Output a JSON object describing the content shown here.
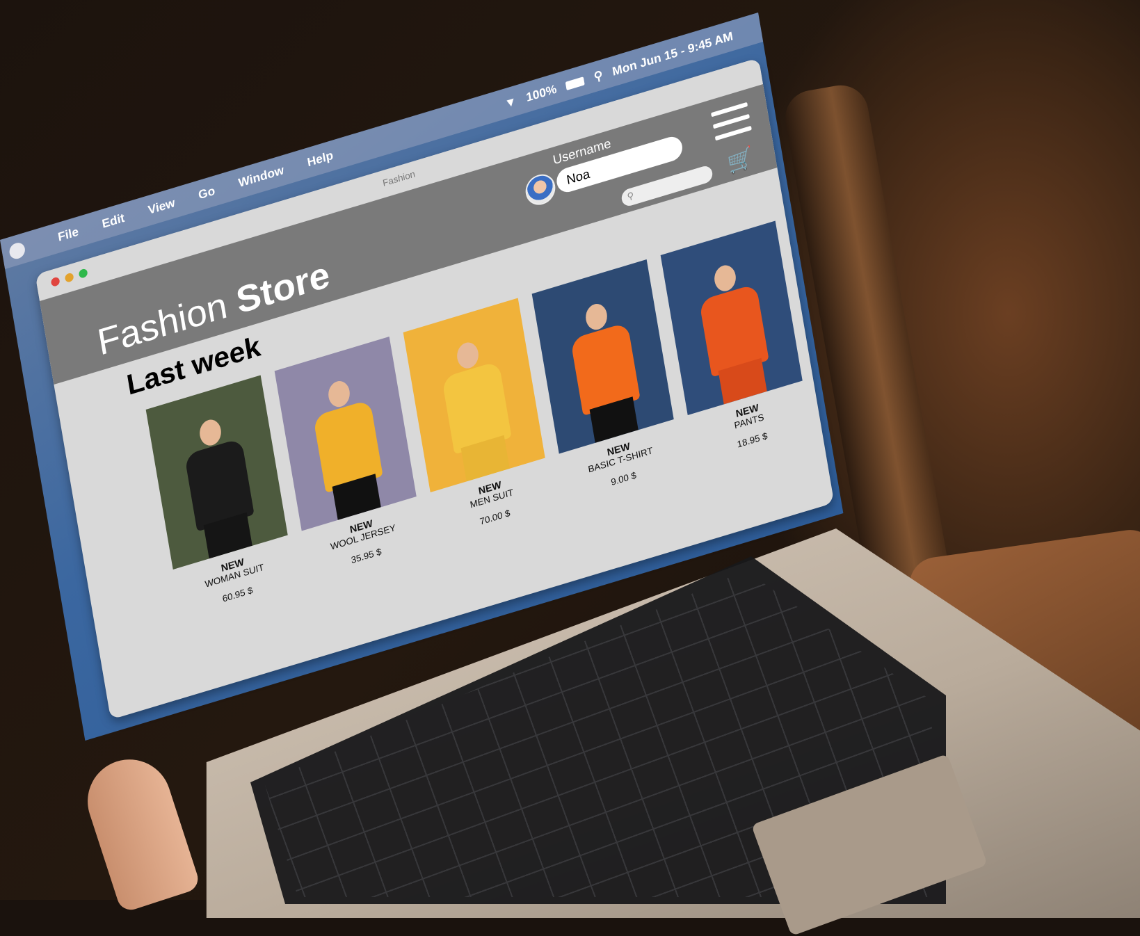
{
  "menubar": {
    "items": [
      "File",
      "Edit",
      "View",
      "Go",
      "Window",
      "Help"
    ],
    "wifi_battery": "100%",
    "clock": "Mon Jun 15 - 9:45 AM"
  },
  "window": {
    "title": "Fashion"
  },
  "store": {
    "brand_light": "Fashion",
    "brand_bold": "Store",
    "username_label": "Username",
    "username_value": "Noa",
    "section_title": "Last week"
  },
  "products": [
    {
      "tag": "NEW",
      "name": "WOMAN SUIT",
      "price": "60.95 $",
      "bg": "#4d5a3e",
      "shirt": "#1b1b1b",
      "legs": "#151515"
    },
    {
      "tag": "NEW",
      "name": "WOOL JERSEY",
      "price": "35.95 $",
      "bg": "#8f88a8",
      "shirt": "#f0b02a",
      "legs": "#111111"
    },
    {
      "tag": "NEW",
      "name": "MEN SUIT",
      "price": "70.00 $",
      "bg": "#f0b23a",
      "shirt": "#f3c540",
      "legs": "#e8b535"
    },
    {
      "tag": "NEW",
      "name": "BASIC T-SHIRT",
      "price": "9.00 $",
      "bg": "#2d4a73",
      "shirt": "#f26a1b",
      "legs": "#111111"
    },
    {
      "tag": "NEW",
      "name": "PANTS",
      "price": "18.95 $",
      "bg": "#2f4d7a",
      "shirt": "#e8561e",
      "legs": "#d84a1a"
    }
  ],
  "colors": {
    "header_gray": "#7a7a7a",
    "window_bg": "#d9d9d9",
    "desktop_blue": "#3b67a0"
  },
  "icons": [
    "wifi-icon",
    "battery-icon",
    "search-icon",
    "cart-icon",
    "hamburger-menu-icon",
    "avatar"
  ]
}
